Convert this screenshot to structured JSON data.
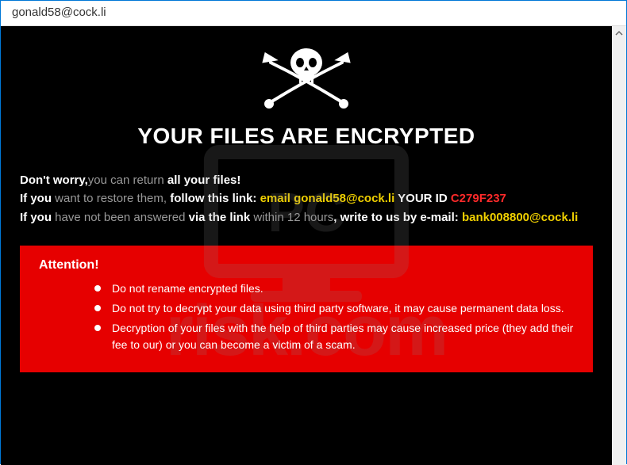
{
  "titlebar": "gonald58@cock.li",
  "headline": "YOUR FILES ARE ENCRYPTED",
  "line1": {
    "a": "Don't worry,",
    "b": "you can return",
    "c": " all your files!"
  },
  "line2": {
    "a": "If you",
    "b": " want to restore them,",
    "c": " follow this link: ",
    "d": "email gonald58@cock.li",
    "e": " YOUR ID ",
    "f": "C279F237"
  },
  "line3": {
    "a": "If you",
    "b": " have not been answered",
    "c": " via the link",
    "d": " within 12 hours",
    "e": ", write to us by e-mail: ",
    "f": "bank008800@cock.li"
  },
  "attention": {
    "title": "Attention!",
    "items": [
      "Do not rename encrypted files.",
      "Do not try to decrypt your data using third party software, it may cause permanent data loss.",
      "Decryption of your files with the help of third parties may cause increased price (they add their fee to our) or you can become a victim of a scam."
    ]
  },
  "watermark_text": "risk.com"
}
